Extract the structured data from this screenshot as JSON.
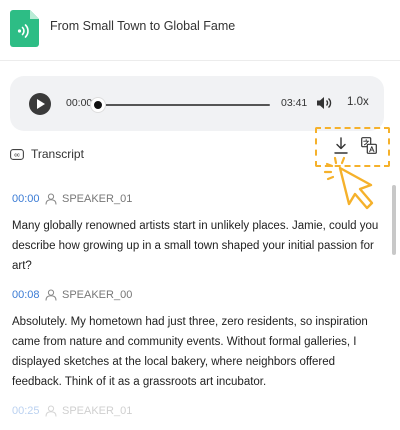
{
  "document": {
    "title": "From Small Town to Global Fame"
  },
  "player": {
    "current_time": "00:00",
    "duration": "03:41",
    "progress": 0,
    "speed": "1.0x"
  },
  "transcript": {
    "label": "Transcript",
    "entries": [
      {
        "timestamp": "00:00",
        "speaker": "SPEAKER_01",
        "text": "Many globally renowned artists start in unlikely places. Jamie, could you describe how growing up in a small town shaped your initial passion for art?"
      },
      {
        "timestamp": "00:08",
        "speaker": "SPEAKER_00",
        "text": "Absolutely. My hometown had just three, zero residents, so inspiration came from nature and community events. Without formal galleries, I displayed sketches at the local bakery, where neighbors offered feedback. Think of it as a grassroots art incubator."
      },
      {
        "timestamp": "00:25",
        "speaker": "SPEAKER_01",
        "text": ""
      }
    ]
  },
  "colors": {
    "accent": "#3a7bd5",
    "brand_green": "#2dbd85",
    "highlight": "#f5b12b"
  }
}
